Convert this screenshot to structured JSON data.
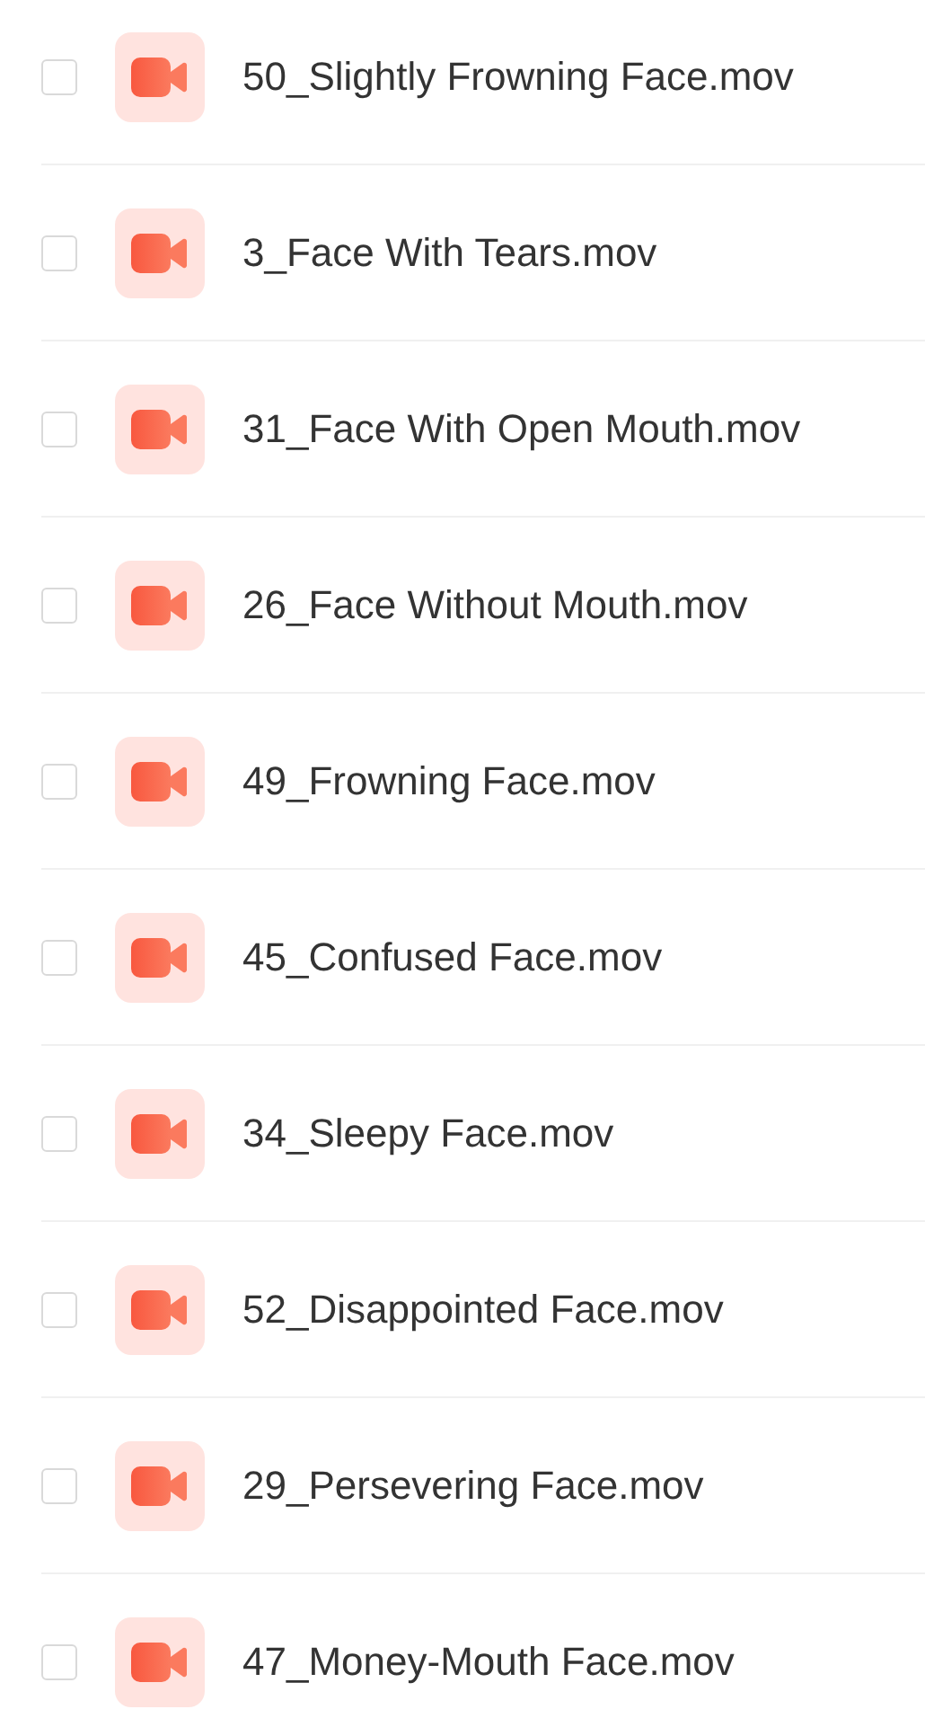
{
  "files": [
    {
      "name": "50_Slightly Frowning Face.mov",
      "checked": false
    },
    {
      "name": "3_Face With Tears.mov",
      "checked": false
    },
    {
      "name": "31_Face With Open Mouth.mov",
      "checked": false
    },
    {
      "name": "26_Face Without Mouth.mov",
      "checked": false
    },
    {
      "name": "49_Frowning Face.mov",
      "checked": false
    },
    {
      "name": "45_Confused Face.mov",
      "checked": false
    },
    {
      "name": "34_Sleepy Face.mov",
      "checked": false
    },
    {
      "name": "52_Disappointed Face.mov",
      "checked": false
    },
    {
      "name": "29_Persevering Face.mov",
      "checked": false
    },
    {
      "name": "47_Money-Mouth Face.mov",
      "checked": false
    }
  ]
}
